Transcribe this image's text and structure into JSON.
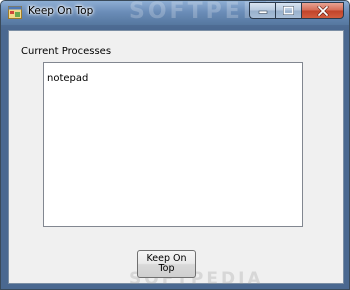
{
  "window": {
    "title": "Keep On Top",
    "icon": "window-app-icon",
    "caption_buttons": [
      "minimize-icon",
      "maximize-icon",
      "close-icon"
    ]
  },
  "processes": {
    "label": "Current Processes",
    "items": [
      "notepad"
    ]
  },
  "actions": {
    "keep_on_top_label": "Keep On Top"
  },
  "watermark": {
    "text": "SOFTPEDIA"
  },
  "colors": {
    "titlebar": "#6b8db8",
    "client_background": "#f0f0f0",
    "close_button": "#c1432a"
  }
}
